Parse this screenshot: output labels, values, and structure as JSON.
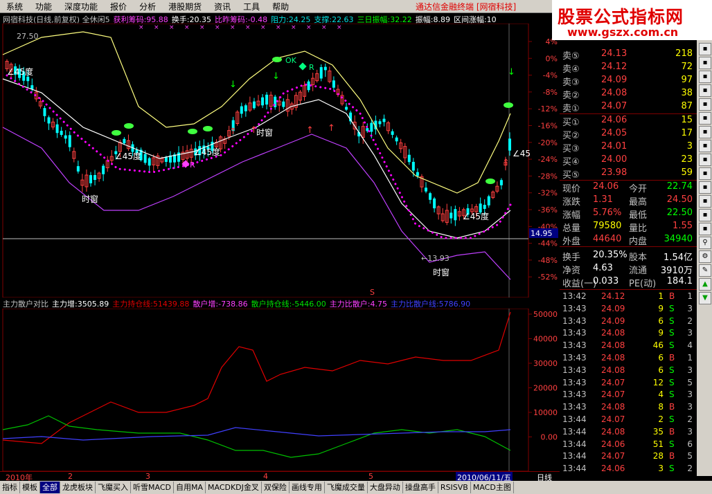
{
  "menu": {
    "items": [
      "系统",
      "功能",
      "深度功能",
      "报价",
      "分析",
      "港股期货",
      "资讯",
      "工具",
      "帮助"
    ],
    "title_right": "通达信金融终端 [网宿科技]"
  },
  "brand": {
    "line1": "股票公式指标网",
    "line2": "www.gszx.com.cn"
  },
  "chart_header": [
    {
      "text": "网宿科技(日线,前复权) 全休闲5",
      "color": "#c0c0c0"
    },
    {
      "text": "获利筹码:95.88",
      "color": "#ff40ff"
    },
    {
      "text": "换手:20.35",
      "color": "#ffffff"
    },
    {
      "text": "比昨筹码:-0.48",
      "color": "#ff40ff"
    },
    {
      "text": "阻力:24.25",
      "color": "#00e0e0"
    },
    {
      "text": "支撑:22.63",
      "color": "#00e0e0"
    },
    {
      "text": "三日振幅:32.22",
      "color": "#00ff00"
    },
    {
      "text": "振幅:8.89",
      "color": "#ffffff"
    },
    {
      "text": "区间涨幅:10",
      "color": "#ffffff"
    }
  ],
  "indicator_header": [
    {
      "text": "主力散户对比",
      "color": "#c0c0c0"
    },
    {
      "text": "主力增:3505.89",
      "color": "#ffffff"
    },
    {
      "text": "主力持仓线:51439.88",
      "color": "#e00000"
    },
    {
      "text": "散户增:-738.86",
      "color": "#ff40ff"
    },
    {
      "text": "散户持仓线:-5446.00",
      "color": "#00e000"
    },
    {
      "text": "主力比散户:4.75",
      "color": "#ff40ff"
    },
    {
      "text": "主力比散户线:5786.90",
      "color": "#4040ff"
    }
  ],
  "main_axis": [
    "4%",
    "0%",
    "-4%",
    "-8%",
    "-12%",
    "-16%",
    "-20%",
    "-24%",
    "-28%",
    "-32%",
    "-36%",
    "-40%",
    "-44%",
    "-48%",
    "-52%"
  ],
  "sub_axis": [
    "50000",
    "40000",
    "30000",
    "20000",
    "10000",
    "0.00"
  ],
  "price_marker": "14.95",
  "annotations": {
    "top_price": "27.50",
    "low_price": "←13.93",
    "angle_labels": [
      "∠45度",
      "∠45度",
      "∠45度",
      "∠45度",
      "∠45"
    ],
    "time_labels": [
      "时窗",
      "时窗",
      "时窗"
    ],
    "ok_label": "OK",
    "r_labels": [
      "R",
      "R"
    ],
    "s_label": "S"
  },
  "order_book": {
    "asks": [
      {
        "label": "卖⑤",
        "price": "24.13",
        "vol": "218"
      },
      {
        "label": "卖④",
        "price": "24.12",
        "vol": "72"
      },
      {
        "label": "卖③",
        "price": "24.09",
        "vol": "97"
      },
      {
        "label": "卖②",
        "price": "24.08",
        "vol": "38"
      },
      {
        "label": "卖①",
        "price": "24.07",
        "vol": "87"
      }
    ],
    "bids": [
      {
        "label": "买①",
        "price": "24.06",
        "vol": "15"
      },
      {
        "label": "买②",
        "price": "24.05",
        "vol": "17"
      },
      {
        "label": "买③",
        "price": "24.01",
        "vol": "3"
      },
      {
        "label": "买④",
        "price": "24.00",
        "vol": "23"
      },
      {
        "label": "买⑤",
        "price": "23.98",
        "vol": "59"
      }
    ]
  },
  "quote": [
    {
      "l1": "现价",
      "v1": "24.06",
      "c1": "#ff4040",
      "l2": "今开",
      "v2": "22.74",
      "c2": "#00ff00"
    },
    {
      "l1": "涨跌",
      "v1": "1.31",
      "c1": "#ff4040",
      "l2": "最高",
      "v2": "24.50",
      "c2": "#ff4040"
    },
    {
      "l1": "涨幅",
      "v1": "5.76%",
      "c1": "#ff4040",
      "l2": "最低",
      "v2": "22.50",
      "c2": "#00ff00"
    },
    {
      "l1": "总量",
      "v1": "79580",
      "c1": "#ffff00",
      "l2": "量比",
      "v2": "1.55",
      "c2": "#ff4040"
    },
    {
      "l1": "外盘",
      "v1": "44640",
      "c1": "#ff4040",
      "l2": "内盘",
      "v2": "34940",
      "c2": "#00ff00"
    },
    {
      "l1": "换手",
      "v1": "20.35%",
      "c1": "#ffffff",
      "l2": "股本",
      "v2": "1.54亿",
      "c2": "#ffffff"
    },
    {
      "l1": "净资",
      "v1": "4.63",
      "c1": "#ffffff",
      "l2": "流通",
      "v2": "3910万",
      "c2": "#ffffff"
    },
    {
      "l1": "收益(一)",
      "v1": "0.033",
      "c1": "#ffffff",
      "l2": "PE(动)",
      "v2": "184.1",
      "c2": "#ffffff"
    }
  ],
  "ticks": [
    {
      "time": "13:42",
      "price": "24.12",
      "vol": "1",
      "side": "B",
      "n": "1"
    },
    {
      "time": "13:43",
      "price": "24.09",
      "vol": "9",
      "side": "S",
      "n": "3"
    },
    {
      "time": "13:43",
      "price": "24.09",
      "vol": "6",
      "side": "S",
      "n": "2"
    },
    {
      "time": "13:43",
      "price": "24.08",
      "vol": "9",
      "side": "S",
      "n": "3"
    },
    {
      "time": "13:43",
      "price": "24.08",
      "vol": "46",
      "side": "S",
      "n": "4"
    },
    {
      "time": "13:43",
      "price": "24.08",
      "vol": "6",
      "side": "B",
      "n": "1"
    },
    {
      "time": "13:43",
      "price": "24.08",
      "vol": "6",
      "side": "S",
      "n": "3"
    },
    {
      "time": "13:43",
      "price": "24.07",
      "vol": "12",
      "side": "S",
      "n": "5"
    },
    {
      "time": "13:43",
      "price": "24.07",
      "vol": "4",
      "side": "S",
      "n": "3"
    },
    {
      "time": "13:43",
      "price": "24.08",
      "vol": "8",
      "side": "B",
      "n": "3"
    },
    {
      "time": "13:44",
      "price": "24.07",
      "vol": "2",
      "side": "S",
      "n": "2"
    },
    {
      "time": "13:44",
      "price": "24.08",
      "vol": "35",
      "side": "B",
      "n": "3"
    },
    {
      "time": "13:44",
      "price": "24.06",
      "vol": "51",
      "side": "S",
      "n": "6"
    },
    {
      "time": "13:44",
      "price": "24.07",
      "vol": "28",
      "side": "B",
      "n": "5"
    },
    {
      "time": "13:44",
      "price": "24.06",
      "vol": "3",
      "side": "S",
      "n": "2"
    }
  ],
  "date_bar": {
    "labels": [
      "2010年",
      "2",
      "3",
      "4",
      "5"
    ],
    "current": "2010/06/11/五",
    "period": "日线"
  },
  "tabs": [
    "指标",
    "模板",
    "全部",
    "龙虎板块",
    "飞魔买入",
    "听雪MACD",
    "自用MA",
    "MACDKDJ金叉",
    "双保险",
    "画线专用",
    "飞魔成交量",
    "大盘异动",
    "操盘高手",
    "RSISVB",
    "MACD主图"
  ],
  "sidebar_icons": [
    "chart-icon",
    "doc-icon",
    "refresh-icon",
    "grid-icon",
    "list-icon",
    "flag-icon",
    "user-icon",
    "link-icon",
    "bars-icon",
    "pie-icon",
    "table-icon",
    "macd-icon",
    "rsi-icon",
    "line-icon",
    "zoom-icon",
    "tools-icon",
    "pen-icon",
    "up-arrow-icon",
    "down-arrow-icon"
  ],
  "colors": {
    "up": "#ff4040",
    "down": "#00ffff",
    "grid": "#800000",
    "ma_pink": "#ff00ff",
    "ma_yellow": "#ffff80"
  }
}
